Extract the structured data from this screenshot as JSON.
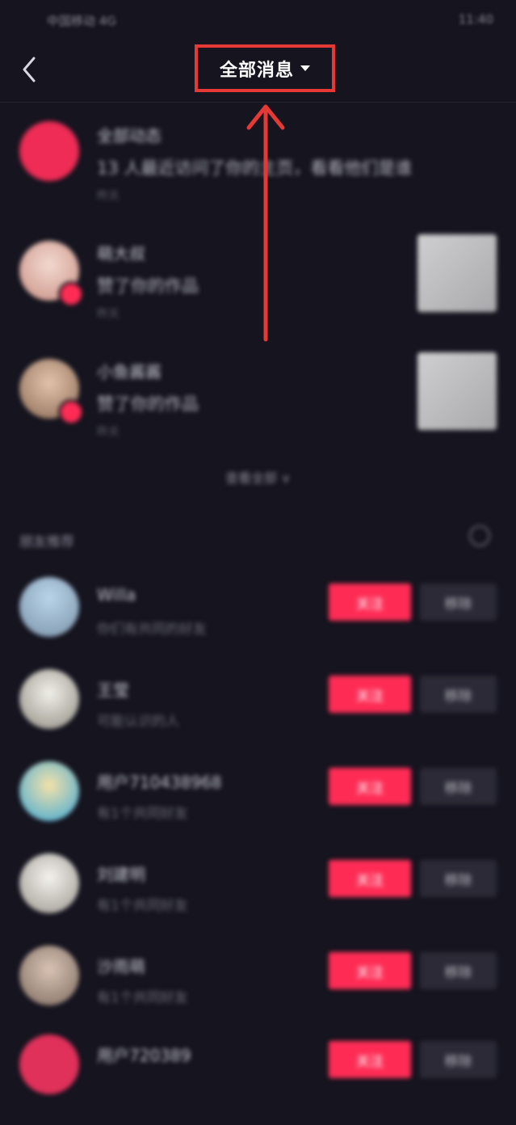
{
  "status_bar": {
    "carrier": "中国移动 4G",
    "time": "11:40"
  },
  "header": {
    "title": "全部消息"
  },
  "notifications": [
    {
      "name": "全部动态",
      "text": "13 人最近访问了你的主页，看看他们是谁",
      "time": "昨天"
    },
    {
      "name": "萌大叔",
      "text": "赞了你的作品",
      "time": "昨天"
    },
    {
      "name": "小鱼酱酱",
      "text": "赞了你的作品",
      "time": "昨天"
    }
  ],
  "expand_label": "查看全部 ∨",
  "recommend": {
    "title": "朋友推荐",
    "items": [
      {
        "name": "Willa",
        "sub": "你们有共同的好友",
        "follow_label": "关注",
        "remove_label": "移除"
      },
      {
        "name": "王莹",
        "sub": "可能认识的人",
        "follow_label": "关注",
        "remove_label": "移除"
      },
      {
        "name": "用户710438968",
        "sub": "有1个共同好友",
        "follow_label": "关注",
        "remove_label": "移除"
      },
      {
        "name": "刘建明",
        "sub": "有1个共同好友",
        "follow_label": "关注",
        "remove_label": "移除"
      },
      {
        "name": "沙雨萌",
        "sub": "有1个共同好友",
        "follow_label": "关注",
        "remove_label": "移除"
      },
      {
        "name": "用户720389",
        "sub": "",
        "follow_label": "关注",
        "remove_label": "移除"
      }
    ]
  },
  "colors": {
    "background": "#15141f",
    "accent": "#fe2c55",
    "annotation": "#e53935"
  }
}
